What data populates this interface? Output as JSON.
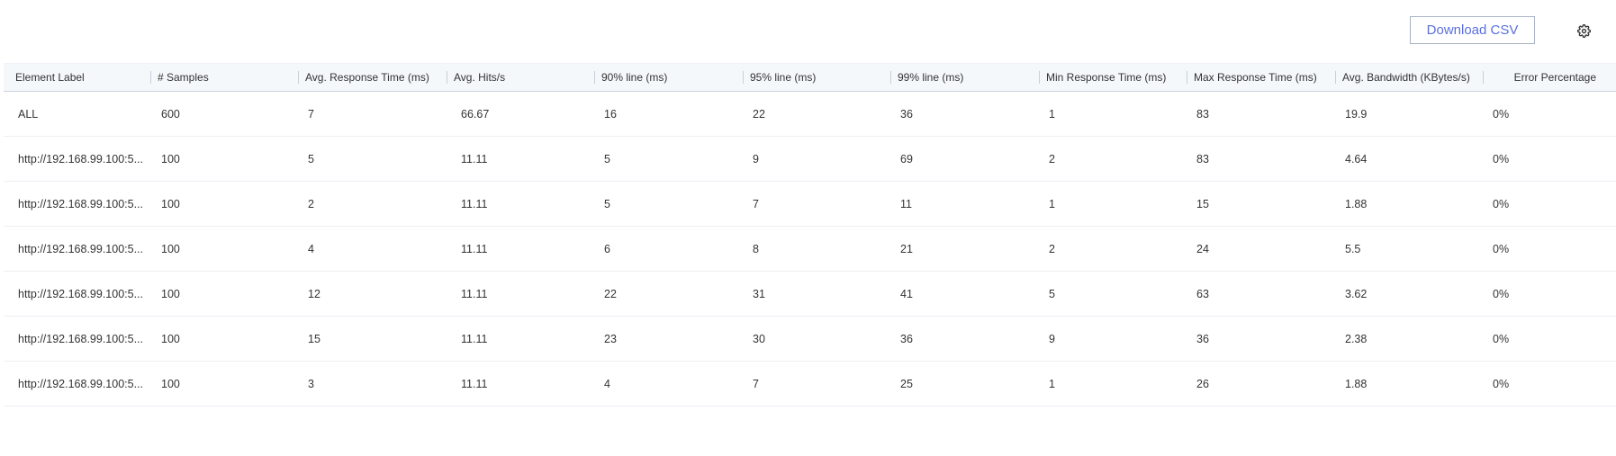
{
  "toolbar": {
    "download_label": "Download CSV",
    "settings_icon": "gear-icon"
  },
  "table": {
    "columns": [
      "Element Label",
      "# Samples",
      "Avg. Response Time (ms)",
      "Avg. Hits/s",
      "90% line (ms)",
      "95% line (ms)",
      "99% line (ms)",
      "Min Response Time (ms)",
      "Max Response Time (ms)",
      "Avg. Bandwidth (KBytes/s)",
      "Error Percentage"
    ],
    "rows": [
      [
        "ALL",
        "600",
        "7",
        "66.67",
        "16",
        "22",
        "36",
        "1",
        "83",
        "19.9",
        "0%"
      ],
      [
        "http://192.168.99.100:5...",
        "100",
        "5",
        "11.11",
        "5",
        "9",
        "69",
        "2",
        "83",
        "4.64",
        "0%"
      ],
      [
        "http://192.168.99.100:5...",
        "100",
        "2",
        "11.11",
        "5",
        "7",
        "11",
        "1",
        "15",
        "1.88",
        "0%"
      ],
      [
        "http://192.168.99.100:5...",
        "100",
        "4",
        "11.11",
        "6",
        "8",
        "21",
        "2",
        "24",
        "5.5",
        "0%"
      ],
      [
        "http://192.168.99.100:5...",
        "100",
        "12",
        "11.11",
        "22",
        "31",
        "41",
        "5",
        "63",
        "3.62",
        "0%"
      ],
      [
        "http://192.168.99.100:5...",
        "100",
        "15",
        "11.11",
        "23",
        "30",
        "36",
        "9",
        "36",
        "2.38",
        "0%"
      ],
      [
        "http://192.168.99.100:5...",
        "100",
        "3",
        "11.11",
        "4",
        "7",
        "25",
        "1",
        "26",
        "1.88",
        "0%"
      ]
    ]
  },
  "colors": {
    "accent": "#5b6fe0",
    "header_bg": "#f5f8fb",
    "border": "#c9d3de"
  }
}
